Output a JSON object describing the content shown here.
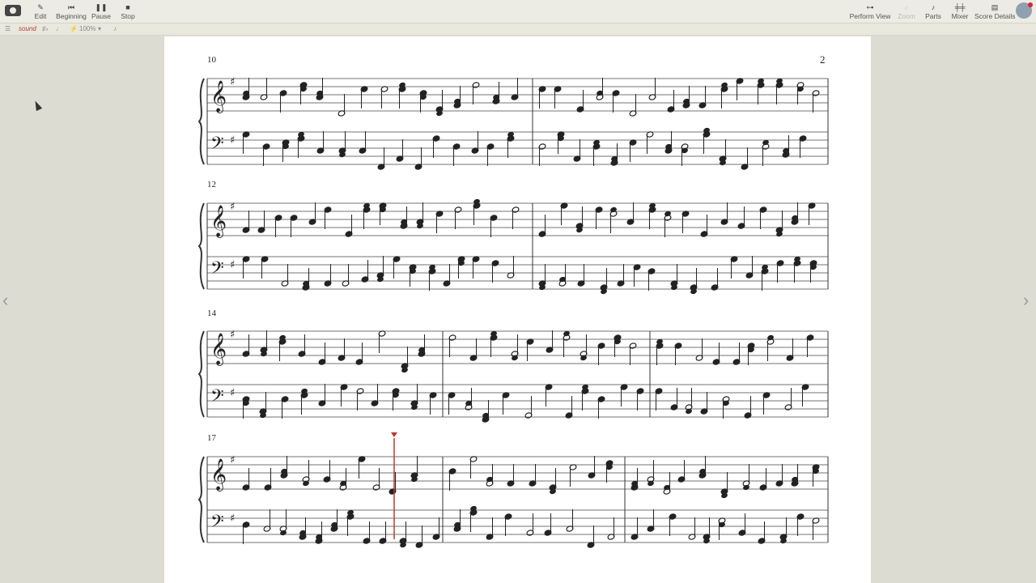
{
  "toolbar": {
    "edit": "Edit",
    "beginning": "Beginning",
    "pause": "Pause",
    "stop": "Stop",
    "perform_view": "Perform View",
    "zoom": "Zoom",
    "parts": "Parts",
    "mixer": "Mixer",
    "score_details": "Score Details"
  },
  "subbar": {
    "sound": "sound",
    "zoom_level": "100%"
  },
  "score": {
    "page_number": "2",
    "measure_numbers": [
      "10",
      "12",
      "14",
      "17"
    ]
  },
  "icons": {
    "edit": "pencil-icon",
    "beginning": "skip-back-icon",
    "pause": "pause-icon",
    "stop": "stop-icon",
    "perform_view": "trumpet-icon",
    "zoom": "magnifier-icon",
    "parts": "guitar-icon",
    "mixer": "sliders-icon",
    "score_details": "document-icon"
  },
  "colors": {
    "playhead": "#c0392b",
    "sound_label": "#c0392b"
  }
}
